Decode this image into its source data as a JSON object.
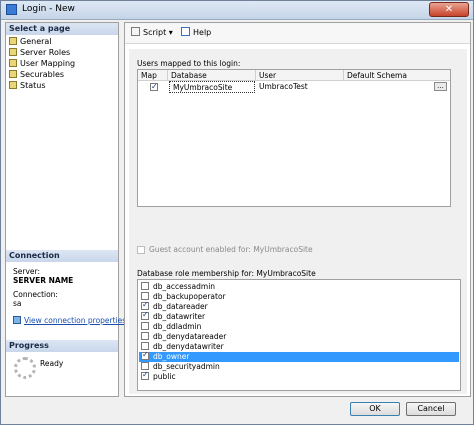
{
  "window": {
    "title": "Login - New",
    "close_label": "✕"
  },
  "left_pane": {
    "select_page_header": "Select a page",
    "pages": [
      "General",
      "Server Roles",
      "User Mapping",
      "Securables",
      "Status"
    ],
    "connection_header": "Connection",
    "server_label": "Server:",
    "server_value": "SERVER NAME",
    "connection_label": "Connection:",
    "connection_value": "sa",
    "view_properties_link": "View connection properties",
    "progress_header": "Progress",
    "progress_status": "Ready"
  },
  "toolbar": {
    "script_label": "Script",
    "help_label": "Help"
  },
  "user_mapping": {
    "label": "Users mapped to this login:",
    "columns": [
      "Map",
      "Database",
      "User",
      "Default Schema"
    ],
    "rows": [
      {
        "map": true,
        "database": "MyUmbracoSite",
        "user": "UmbracoTest",
        "default_schema": ""
      }
    ],
    "ellipsis_label": "..."
  },
  "guest": {
    "label": "Guest account enabled for: MyUmbracoSite",
    "checked": false
  },
  "roles": {
    "label": "Database role membership for: MyUmbracoSite",
    "items": [
      {
        "name": "db_accessadmin",
        "checked": false,
        "selected": false
      },
      {
        "name": "db_backupoperator",
        "checked": false,
        "selected": false
      },
      {
        "name": "db_datareader",
        "checked": true,
        "selected": false
      },
      {
        "name": "db_datawriter",
        "checked": true,
        "selected": false
      },
      {
        "name": "db_ddladmin",
        "checked": false,
        "selected": false
      },
      {
        "name": "db_denydatareader",
        "checked": false,
        "selected": false
      },
      {
        "name": "db_denydatawriter",
        "checked": false,
        "selected": false
      },
      {
        "name": "db_owner",
        "checked": true,
        "selected": true
      },
      {
        "name": "db_securityadmin",
        "checked": false,
        "selected": false
      },
      {
        "name": "public",
        "checked": true,
        "selected": false
      }
    ]
  },
  "buttons": {
    "ok": "OK",
    "cancel": "Cancel"
  }
}
